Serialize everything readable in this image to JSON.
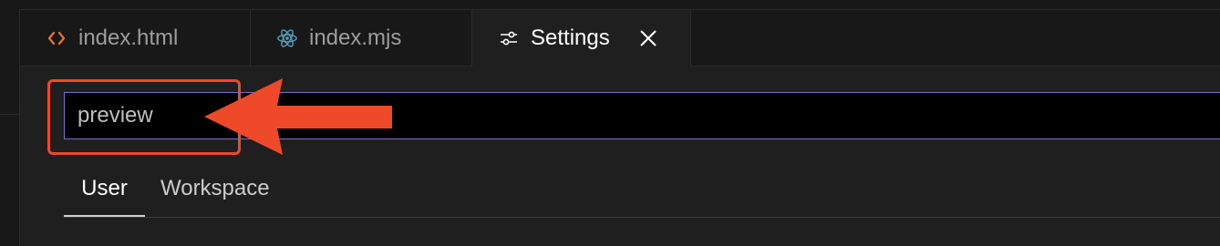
{
  "tabs": [
    {
      "label": "index.html",
      "icon": "html-code-icon",
      "color": "#e37933"
    },
    {
      "label": "index.mjs",
      "icon": "react-icon",
      "color": "#519aba"
    },
    {
      "label": "Settings",
      "icon": "settings-sliders-icon",
      "active": true
    }
  ],
  "search": {
    "value": "preview",
    "border_color": "#7f6cc7"
  },
  "scope_tabs": [
    {
      "label": "User",
      "active": true
    },
    {
      "label": "Workspace"
    }
  ],
  "annotation": {
    "color": "#ee4a2a",
    "shapes": [
      "highlight-box",
      "arrow"
    ]
  }
}
